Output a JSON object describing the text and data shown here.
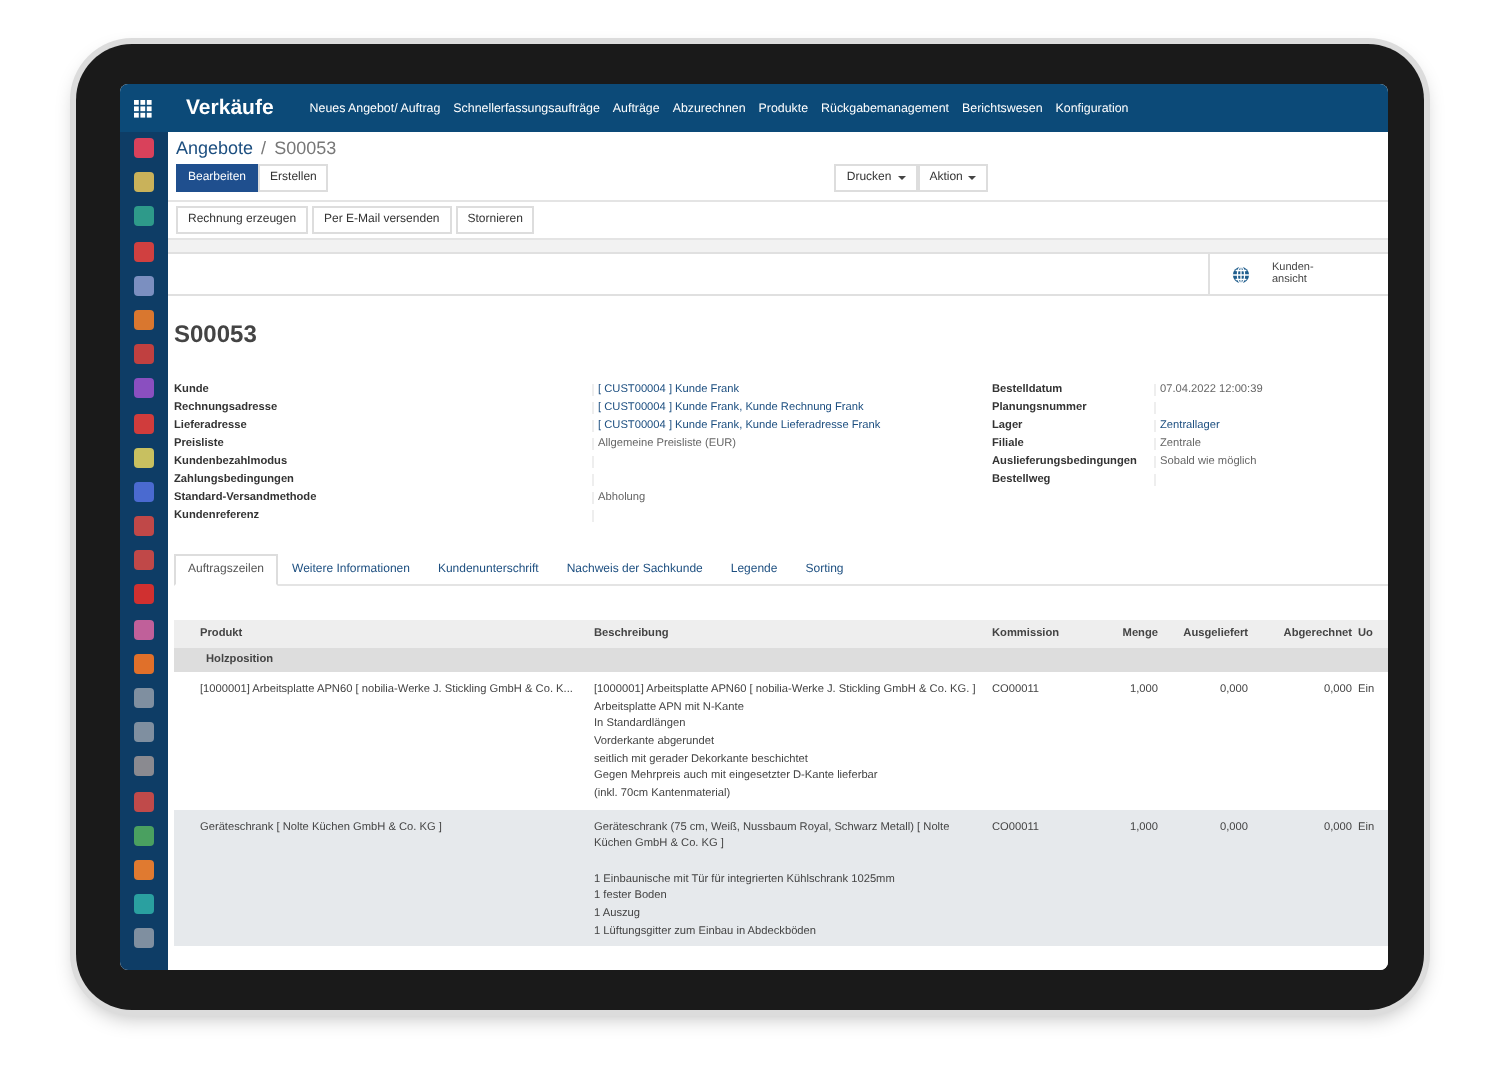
{
  "app_title": "Verkäufe",
  "menu": [
    "Neues Angebot/ Auftrag",
    "Schnellerfassungsaufträge",
    "Aufträge",
    "Abzurechnen",
    "Produkte",
    "Rückgabemanagement",
    "Berichtswesen",
    "Konfiguration"
  ],
  "breadcrumb": {
    "parent": "Angebote",
    "separator": "/",
    "current": "S00053"
  },
  "primary_buttons": [
    {
      "label": "Bearbeiten",
      "primary": true
    },
    {
      "label": "Erstellen",
      "primary": false
    }
  ],
  "dropdowns": [
    "Drucken",
    "Aktion"
  ],
  "action_buttons": [
    "Rechnung erzeugen",
    "Per E-Mail versenden",
    "Stornieren"
  ],
  "smart_button": {
    "label": "Kunden-\nansicht"
  },
  "record_title": "S00053",
  "left_fields": [
    {
      "label": "Kunde",
      "value": "[ CUST00004 ] Kunde Frank",
      "link": true
    },
    {
      "label": "Rechnungsadresse",
      "value": "[ CUST00004 ] Kunde Frank, Kunde Rechnung Frank",
      "link": true
    },
    {
      "label": "Lieferadresse",
      "value": "[ CUST00004 ] Kunde Frank, Kunde Lieferadresse Frank",
      "link": true
    },
    {
      "label": "Preisliste",
      "value": "Allgemeine Preisliste (EUR)",
      "link": false
    },
    {
      "label": "Kundenbezahlmodus"
    },
    {
      "label": "Zahlungsbedingungen"
    },
    {
      "label": "Standard-Versandmethode",
      "value": "Abholung",
      "link": false
    },
    {
      "label": "Kundenreferenz"
    }
  ],
  "right_fields": [
    {
      "label": "Bestelldatum",
      "value": "07.04.2022 12:00:39",
      "link": false
    },
    {
      "label": "Planungsnummer"
    },
    {
      "label": "Lager",
      "value": "Zentrallager",
      "link": true
    },
    {
      "label": "Filiale",
      "value": "Zentrale",
      "link": false
    },
    {
      "label": "Auslieferungsbedingungen",
      "value": "Sobald wie möglich",
      "link": false
    },
    {
      "label": "Bestellweg"
    }
  ],
  "tabs": [
    {
      "label": "Auftragszeilen",
      "selected": true
    },
    {
      "label": "Weitere Informationen",
      "selected": false
    },
    {
      "label": "Kundenunterschrift",
      "selected": false
    },
    {
      "label": "Nachweis der Sachkunde",
      "selected": false
    },
    {
      "label": "Legende",
      "selected": false
    },
    {
      "label": "Sorting",
      "selected": false
    }
  ],
  "table": {
    "columns": [
      "Produkt",
      "Beschreibung",
      "Kommission",
      "Menge",
      "Ausgeliefert",
      "Abgerechnet",
      "Uo"
    ],
    "section": "Holzposition",
    "rows": [
      {
        "selected": false,
        "cells": [
          "[1000001] Arbeitsplatte APN60 [ nobilia-Werke J. Stickling GmbH & Co. K...",
          "[1000001] Arbeitsplatte APN60 [ nobilia-Werke J. Stickling GmbH & Co. KG. ]\nArbeitsplatte APN mit N-Kante\nIn Standardlängen\nVorderkante abgerundet\nseitlich mit gerader Dekorkante beschichtet\nGegen Mehrpreis auch mit eingesetzter D-Kante lieferbar\n(inkl. 70cm Kantenmaterial)",
          "CO00011",
          "1,000",
          "0,000",
          "0,000",
          "Ein"
        ]
      },
      {
        "selected": true,
        "cells": [
          "Geräteschrank [ Nolte Küchen GmbH & Co. KG ]",
          "Geräteschrank (75 cm, Weiß, Nussbaum Royal, Schwarz Metall) [ Nolte Küchen GmbH & Co. KG ]\n\n1 Einbaunische mit Tür für integrierten Kühlschrank 1025mm\n1 fester Boden\n1 Auszug\n1 Lüftungsgitter zum Einbau in Abdeckböden",
          "CO00011",
          "1,000",
          "0,000",
          "0,000",
          "Ein"
        ]
      }
    ]
  }
}
